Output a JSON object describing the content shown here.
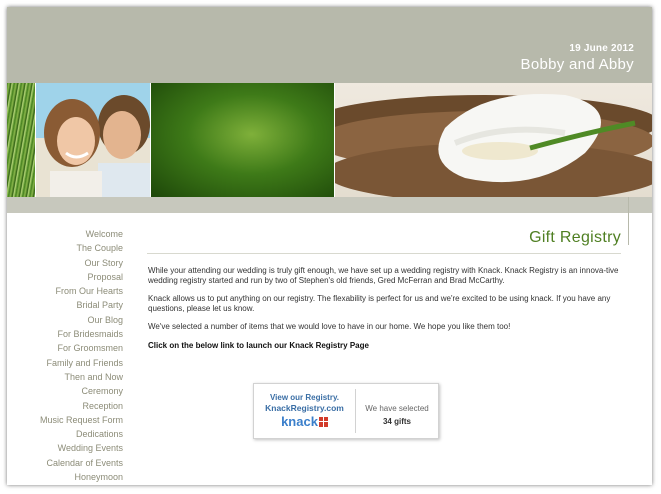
{
  "header": {
    "date": "19 June 2012",
    "couple": "Bobby and Abby",
    "bg_color": "#b7b9ab"
  },
  "banner": {
    "images": [
      "grass-photo",
      "couple-photo",
      "green-blur-photo",
      "calla-lily-photo"
    ]
  },
  "nav": {
    "items": [
      {
        "label": "Welcome"
      },
      {
        "label": "The Couple"
      },
      {
        "label": "Our Story"
      },
      {
        "label": "Proposal"
      },
      {
        "label": "From Our Hearts"
      },
      {
        "label": "Bridal Party"
      },
      {
        "label": "Our Blog"
      },
      {
        "label": "For Bridesmaids"
      },
      {
        "label": "For Groomsmen"
      },
      {
        "label": "Family and Friends"
      },
      {
        "label": "Then and Now"
      },
      {
        "label": "Ceremony"
      },
      {
        "label": "Reception"
      },
      {
        "label": "Music Request Form"
      },
      {
        "label": "Dedications"
      },
      {
        "label": "Wedding Events"
      },
      {
        "label": "Calendar of Events"
      },
      {
        "label": "Honeymoon"
      }
    ]
  },
  "main": {
    "title": "Gift Registry",
    "title_color": "#4f7f22",
    "paragraphs": [
      "While your attending our wedding is truly gift enough, we have set up a wedding registry with Knack.  Knack Registry is an innova-tive wedding registry started and run by two of Stephen's old friends, Gred McFerran and Brad McCarthy.",
      "Knack allows us to put anything on our registry.  The flexability is perfect for us and we're excited to be using knack.  If you have any questions, please let us know.",
      "We've selected a number of items that we would love to have in our home.  We hope you like them too!"
    ],
    "cta": "Click on the below link to launch our Knack Registry Page"
  },
  "registry_widget": {
    "view_label": "View our Registry.",
    "site": "KnackRegistry.com",
    "logo_text": "knack",
    "have_selected": "We have selected",
    "gift_count": "34 gifts",
    "accent_color": "#3a6ea5"
  }
}
